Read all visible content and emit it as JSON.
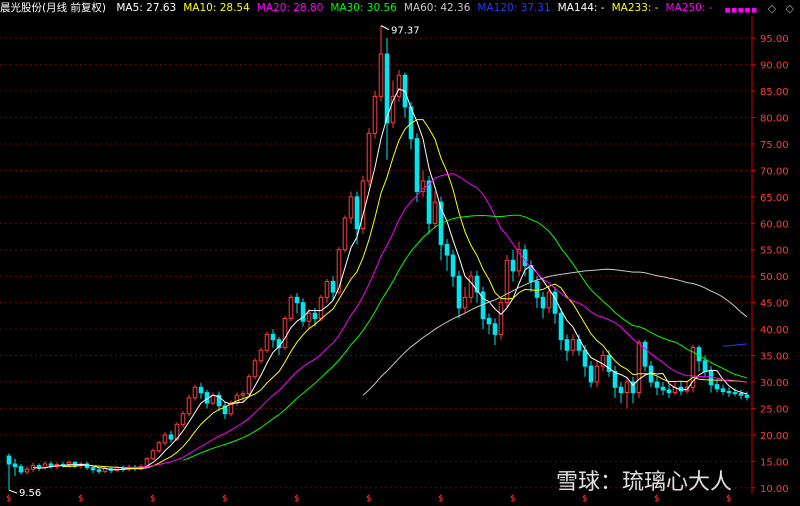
{
  "legend": {
    "title": "晨光股份(月线 前复权)",
    "items": [
      {
        "label": "MA5: 27.63",
        "color": "#ffffff"
      },
      {
        "label": "MA10: 28.54",
        "color": "#ffff00"
      },
      {
        "label": "MA20: 28.80",
        "color": "#ff00ff"
      },
      {
        "label": "MA30: 30.56",
        "color": "#00ff00"
      },
      {
        "label": "MA60: 42.36",
        "color": "#c8c8c8"
      },
      {
        "label": "MA120: 37.31",
        "color": "#1e3cff"
      },
      {
        "label": "MA144: -",
        "color": "#ffffff"
      },
      {
        "label": "MA233: -",
        "color": "#ffff00"
      },
      {
        "label": "MA250: -",
        "color": "#ff00ff"
      }
    ]
  },
  "toolbar": {
    "dots": "■■■■■",
    "diamond": "◇",
    "chevron": "◇"
  },
  "watermark": "雪球：琉璃心大人",
  "colors": {
    "up": "#ff3c3c",
    "down": "#00e5ee",
    "grid": "#7a0000",
    "axis": "#cc0000",
    "tick": "#ff3c3c"
  },
  "chart_data": {
    "type": "candlestick",
    "title": "晨光股份(月线 前复权)",
    "ylim": [
      10,
      97
    ],
    "y_ticks": [
      "95.00",
      "90.00",
      "85.00",
      "80.00",
      "75.00",
      "70.00",
      "65.00",
      "60.00",
      "55.00",
      "50.00",
      "45.00",
      "40.00",
      "35.00",
      "30.00",
      "25.00",
      "20.00",
      "15.00",
      "10.00"
    ],
    "annotations": [
      {
        "text": "97.37",
        "type": "high"
      },
      {
        "text": "9.56",
        "type": "low"
      }
    ],
    "candles": [
      [
        16,
        14.5,
        16.5,
        9.56
      ],
      [
        14.5,
        14,
        15.5,
        12.2
      ],
      [
        14,
        13,
        14.5,
        12.5
      ],
      [
        13,
        13.5,
        14,
        12.5
      ],
      [
        13.5,
        14.2,
        14.8,
        13
      ],
      [
        14.2,
        13.8,
        14.6,
        13.2
      ],
      [
        13.8,
        14.5,
        15,
        13.4
      ],
      [
        14.5,
        14,
        15,
        13.6
      ],
      [
        14,
        14.4,
        14.8,
        13.5
      ],
      [
        14.4,
        14.2,
        14.9,
        13.8
      ],
      [
        14.2,
        14.8,
        15.2,
        13.8
      ],
      [
        14.8,
        14.2,
        15,
        13.7
      ],
      [
        14.2,
        14.5,
        14.8,
        13.6
      ],
      [
        14.5,
        13.8,
        14.9,
        13.4
      ],
      [
        13.8,
        13.4,
        14.2,
        12.8
      ],
      [
        13.4,
        13.1,
        13.8,
        12.6
      ],
      [
        13.1,
        13.6,
        14,
        12.8
      ],
      [
        13.6,
        13.3,
        13.9,
        12.8
      ],
      [
        13.3,
        13.8,
        14.1,
        13
      ],
      [
        13.8,
        13.5,
        14.2,
        13
      ],
      [
        13.5,
        13.9,
        14.4,
        13.1
      ],
      [
        13.9,
        13.6,
        14.3,
        13.2
      ],
      [
        13.6,
        14,
        14.5,
        13.3
      ],
      [
        14,
        15.5,
        15.8,
        13.8
      ],
      [
        15.5,
        17,
        17.4,
        15.2
      ],
      [
        17,
        18.5,
        18.9,
        16.6
      ],
      [
        18.5,
        20,
        20.5,
        18
      ],
      [
        20,
        19.2,
        20.8,
        18.5
      ],
      [
        19.2,
        22,
        22.4,
        18.8
      ],
      [
        22,
        24,
        24.5,
        21.5
      ],
      [
        24,
        27,
        27.6,
        23.5
      ],
      [
        27,
        29,
        29.5,
        26.5
      ],
      [
        29,
        28,
        29.8,
        26.8
      ],
      [
        28,
        26,
        28.5,
        25
      ],
      [
        26,
        27.5,
        28,
        25.5
      ],
      [
        27.5,
        25.5,
        28.2,
        24.5
      ],
      [
        25.5,
        24,
        26.2,
        23
      ],
      [
        24,
        26,
        26.5,
        23.5
      ],
      [
        26,
        27.5,
        28,
        25.5
      ],
      [
        27.5,
        27.8,
        28.3,
        26
      ],
      [
        27.8,
        31,
        31.5,
        27
      ],
      [
        31,
        34,
        34.5,
        30.5
      ],
      [
        34,
        36,
        36.5,
        33.5
      ],
      [
        36,
        39,
        39.5,
        35.5
      ],
      [
        39,
        38,
        40,
        36.5
      ],
      [
        38,
        36.5,
        38.5,
        35
      ],
      [
        36.5,
        42,
        42.5,
        36
      ],
      [
        42,
        46,
        46.5,
        41.5
      ],
      [
        46,
        45,
        46.8,
        43
      ],
      [
        45,
        41.5,
        45.8,
        40.5
      ],
      [
        41.5,
        43,
        43.8,
        40
      ],
      [
        43,
        42,
        44,
        40.5
      ],
      [
        42,
        46,
        46.5,
        41.5
      ],
      [
        46,
        49,
        49.5,
        45
      ],
      [
        49,
        47,
        50,
        45.5
      ],
      [
        47,
        55,
        55.5,
        46.5
      ],
      [
        55,
        61,
        61.5,
        54.5
      ],
      [
        61,
        65,
        66,
        60
      ],
      [
        65,
        59,
        66,
        56
      ],
      [
        59,
        68,
        69,
        58
      ],
      [
        68,
        77,
        78,
        67
      ],
      [
        77,
        84,
        85,
        76
      ],
      [
        84,
        92,
        97.37,
        83
      ],
      [
        92,
        79,
        95,
        72
      ],
      [
        79,
        84,
        87,
        78
      ],
      [
        84,
        88,
        89,
        83
      ],
      [
        88,
        82,
        88.5,
        80
      ],
      [
        82,
        76,
        83,
        74
      ],
      [
        76,
        66,
        77,
        64
      ],
      [
        66,
        68,
        70,
        65
      ],
      [
        68,
        60,
        69,
        58
      ],
      [
        60,
        64,
        66,
        59
      ],
      [
        64,
        56,
        65,
        53
      ],
      [
        56,
        54,
        57,
        51
      ],
      [
        54,
        50,
        55,
        48
      ],
      [
        50,
        44,
        51,
        42
      ],
      [
        44,
        46,
        48,
        43
      ],
      [
        46,
        50,
        51,
        45
      ],
      [
        50,
        47,
        51,
        45
      ],
      [
        47,
        42,
        48,
        40
      ],
      [
        42,
        41,
        43,
        39
      ],
      [
        41,
        39,
        42,
        37
      ],
      [
        39,
        45,
        46,
        38
      ],
      [
        45,
        53,
        54,
        44
      ],
      [
        53,
        51,
        55,
        49
      ],
      [
        51,
        55,
        56.5,
        50
      ],
      [
        55,
        52,
        56,
        50
      ],
      [
        52,
        49,
        53,
        47
      ],
      [
        49,
        46,
        50,
        44
      ],
      [
        46,
        44,
        47,
        42
      ],
      [
        44,
        47,
        48,
        43
      ],
      [
        47,
        43,
        48,
        41
      ],
      [
        43,
        38,
        44,
        36
      ],
      [
        38,
        36,
        39,
        34
      ],
      [
        36,
        38,
        39,
        35
      ],
      [
        38,
        36,
        39,
        35
      ],
      [
        36,
        33,
        37,
        31
      ],
      [
        33,
        30,
        34,
        29
      ],
      [
        30,
        33,
        34,
        29
      ],
      [
        33,
        35,
        36,
        32
      ],
      [
        35,
        32,
        36,
        31
      ],
      [
        32,
        29,
        33,
        27
      ],
      [
        29,
        28,
        30,
        26
      ],
      [
        28,
        30,
        31,
        25
      ],
      [
        30,
        28,
        31,
        26
      ],
      [
        28,
        37.5,
        38,
        27
      ],
      [
        37.5,
        33,
        38,
        32
      ],
      [
        33,
        30,
        34,
        29
      ],
      [
        30,
        29,
        31,
        27.5
      ],
      [
        29,
        28.5,
        30,
        27.5
      ],
      [
        28.5,
        28,
        29.5,
        27
      ],
      [
        28,
        29,
        30,
        27.5
      ],
      [
        29,
        28.3,
        30,
        27.5
      ],
      [
        28.3,
        29,
        30,
        27.8
      ],
      [
        29,
        36.5,
        37,
        28
      ],
      [
        36.5,
        34,
        37,
        32
      ],
      [
        34,
        32,
        35,
        31
      ],
      [
        32,
        29.5,
        33,
        28
      ],
      [
        29.5,
        28.7,
        30.5,
        28
      ],
      [
        28.7,
        28.2,
        29.5,
        27.5
      ],
      [
        28.2,
        28,
        29,
        27.2
      ],
      [
        28,
        27.8,
        28.8,
        27.3
      ],
      [
        27.8,
        27.5,
        28.5,
        26.8
      ],
      [
        27.5,
        27.1,
        28.2,
        26.5
      ]
    ],
    "ma_periods": [
      5,
      10,
      20,
      30,
      60,
      120
    ]
  }
}
